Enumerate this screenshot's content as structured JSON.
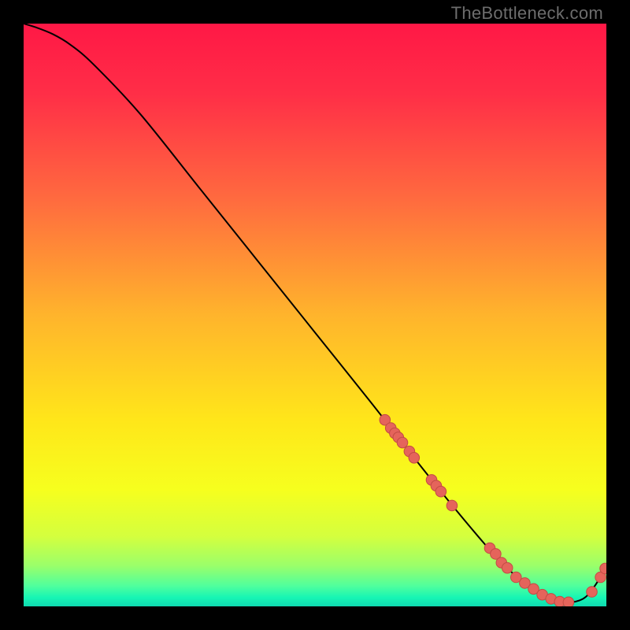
{
  "watermark": "TheBottleneck.com",
  "chart_data": {
    "type": "line",
    "title": "",
    "xlabel": "",
    "ylabel": "",
    "xlim": [
      0,
      100
    ],
    "ylim": [
      0,
      100
    ],
    "gradient_stops": [
      {
        "offset": 0.0,
        "color": "#ff1846"
      },
      {
        "offset": 0.12,
        "color": "#ff2e47"
      },
      {
        "offset": 0.3,
        "color": "#ff6a3f"
      },
      {
        "offset": 0.5,
        "color": "#ffb42c"
      },
      {
        "offset": 0.68,
        "color": "#ffe61a"
      },
      {
        "offset": 0.8,
        "color": "#f6ff1e"
      },
      {
        "offset": 0.88,
        "color": "#d4ff3e"
      },
      {
        "offset": 0.93,
        "color": "#9bff6a"
      },
      {
        "offset": 0.965,
        "color": "#4fff9d"
      },
      {
        "offset": 0.985,
        "color": "#17f5b4"
      },
      {
        "offset": 1.0,
        "color": "#0fdab0"
      }
    ],
    "series": [
      {
        "name": "bottleneck-curve",
        "x": [
          0,
          2,
          5,
          8,
          12,
          20,
          30,
          40,
          50,
          60,
          67,
          73,
          78,
          82,
          86,
          90,
          93,
          96,
          98,
          100
        ],
        "y": [
          100,
          99.4,
          98.2,
          96.4,
          93.0,
          84.5,
          72.0,
          59.5,
          47.0,
          34.5,
          25.5,
          18.0,
          12.0,
          7.5,
          4.0,
          1.6,
          0.7,
          1.3,
          3.5,
          6.8
        ]
      }
    ],
    "marker_clusters": [
      {
        "name": "upper-segment",
        "points": [
          {
            "x": 62,
            "y": 32.0
          },
          {
            "x": 63,
            "y": 30.6
          },
          {
            "x": 63.7,
            "y": 29.7
          },
          {
            "x": 64.3,
            "y": 29.0
          },
          {
            "x": 65.0,
            "y": 28.1
          },
          {
            "x": 66.2,
            "y": 26.6
          },
          {
            "x": 67.0,
            "y": 25.5
          }
        ]
      },
      {
        "name": "mid-segment",
        "points": [
          {
            "x": 70.0,
            "y": 21.7
          },
          {
            "x": 70.8,
            "y": 20.7
          },
          {
            "x": 71.6,
            "y": 19.7
          },
          {
            "x": 73.5,
            "y": 17.3
          }
        ]
      },
      {
        "name": "valley-segment",
        "points": [
          {
            "x": 80.0,
            "y": 10.0
          },
          {
            "x": 81.0,
            "y": 9.0
          },
          {
            "x": 82.0,
            "y": 7.5
          },
          {
            "x": 83.0,
            "y": 6.6
          },
          {
            "x": 84.5,
            "y": 5.0
          },
          {
            "x": 86.0,
            "y": 4.0
          },
          {
            "x": 87.5,
            "y": 3.0
          },
          {
            "x": 89.0,
            "y": 2.0
          },
          {
            "x": 90.5,
            "y": 1.3
          },
          {
            "x": 92.0,
            "y": 0.8
          },
          {
            "x": 93.5,
            "y": 0.7
          }
        ]
      },
      {
        "name": "rise-segment",
        "points": [
          {
            "x": 97.5,
            "y": 2.5
          },
          {
            "x": 99.0,
            "y": 5.0
          },
          {
            "x": 99.8,
            "y": 6.5
          }
        ]
      }
    ],
    "colors": {
      "curve": "#000000",
      "marker_fill": "#e5645b",
      "marker_stroke": "#c34b44"
    }
  }
}
